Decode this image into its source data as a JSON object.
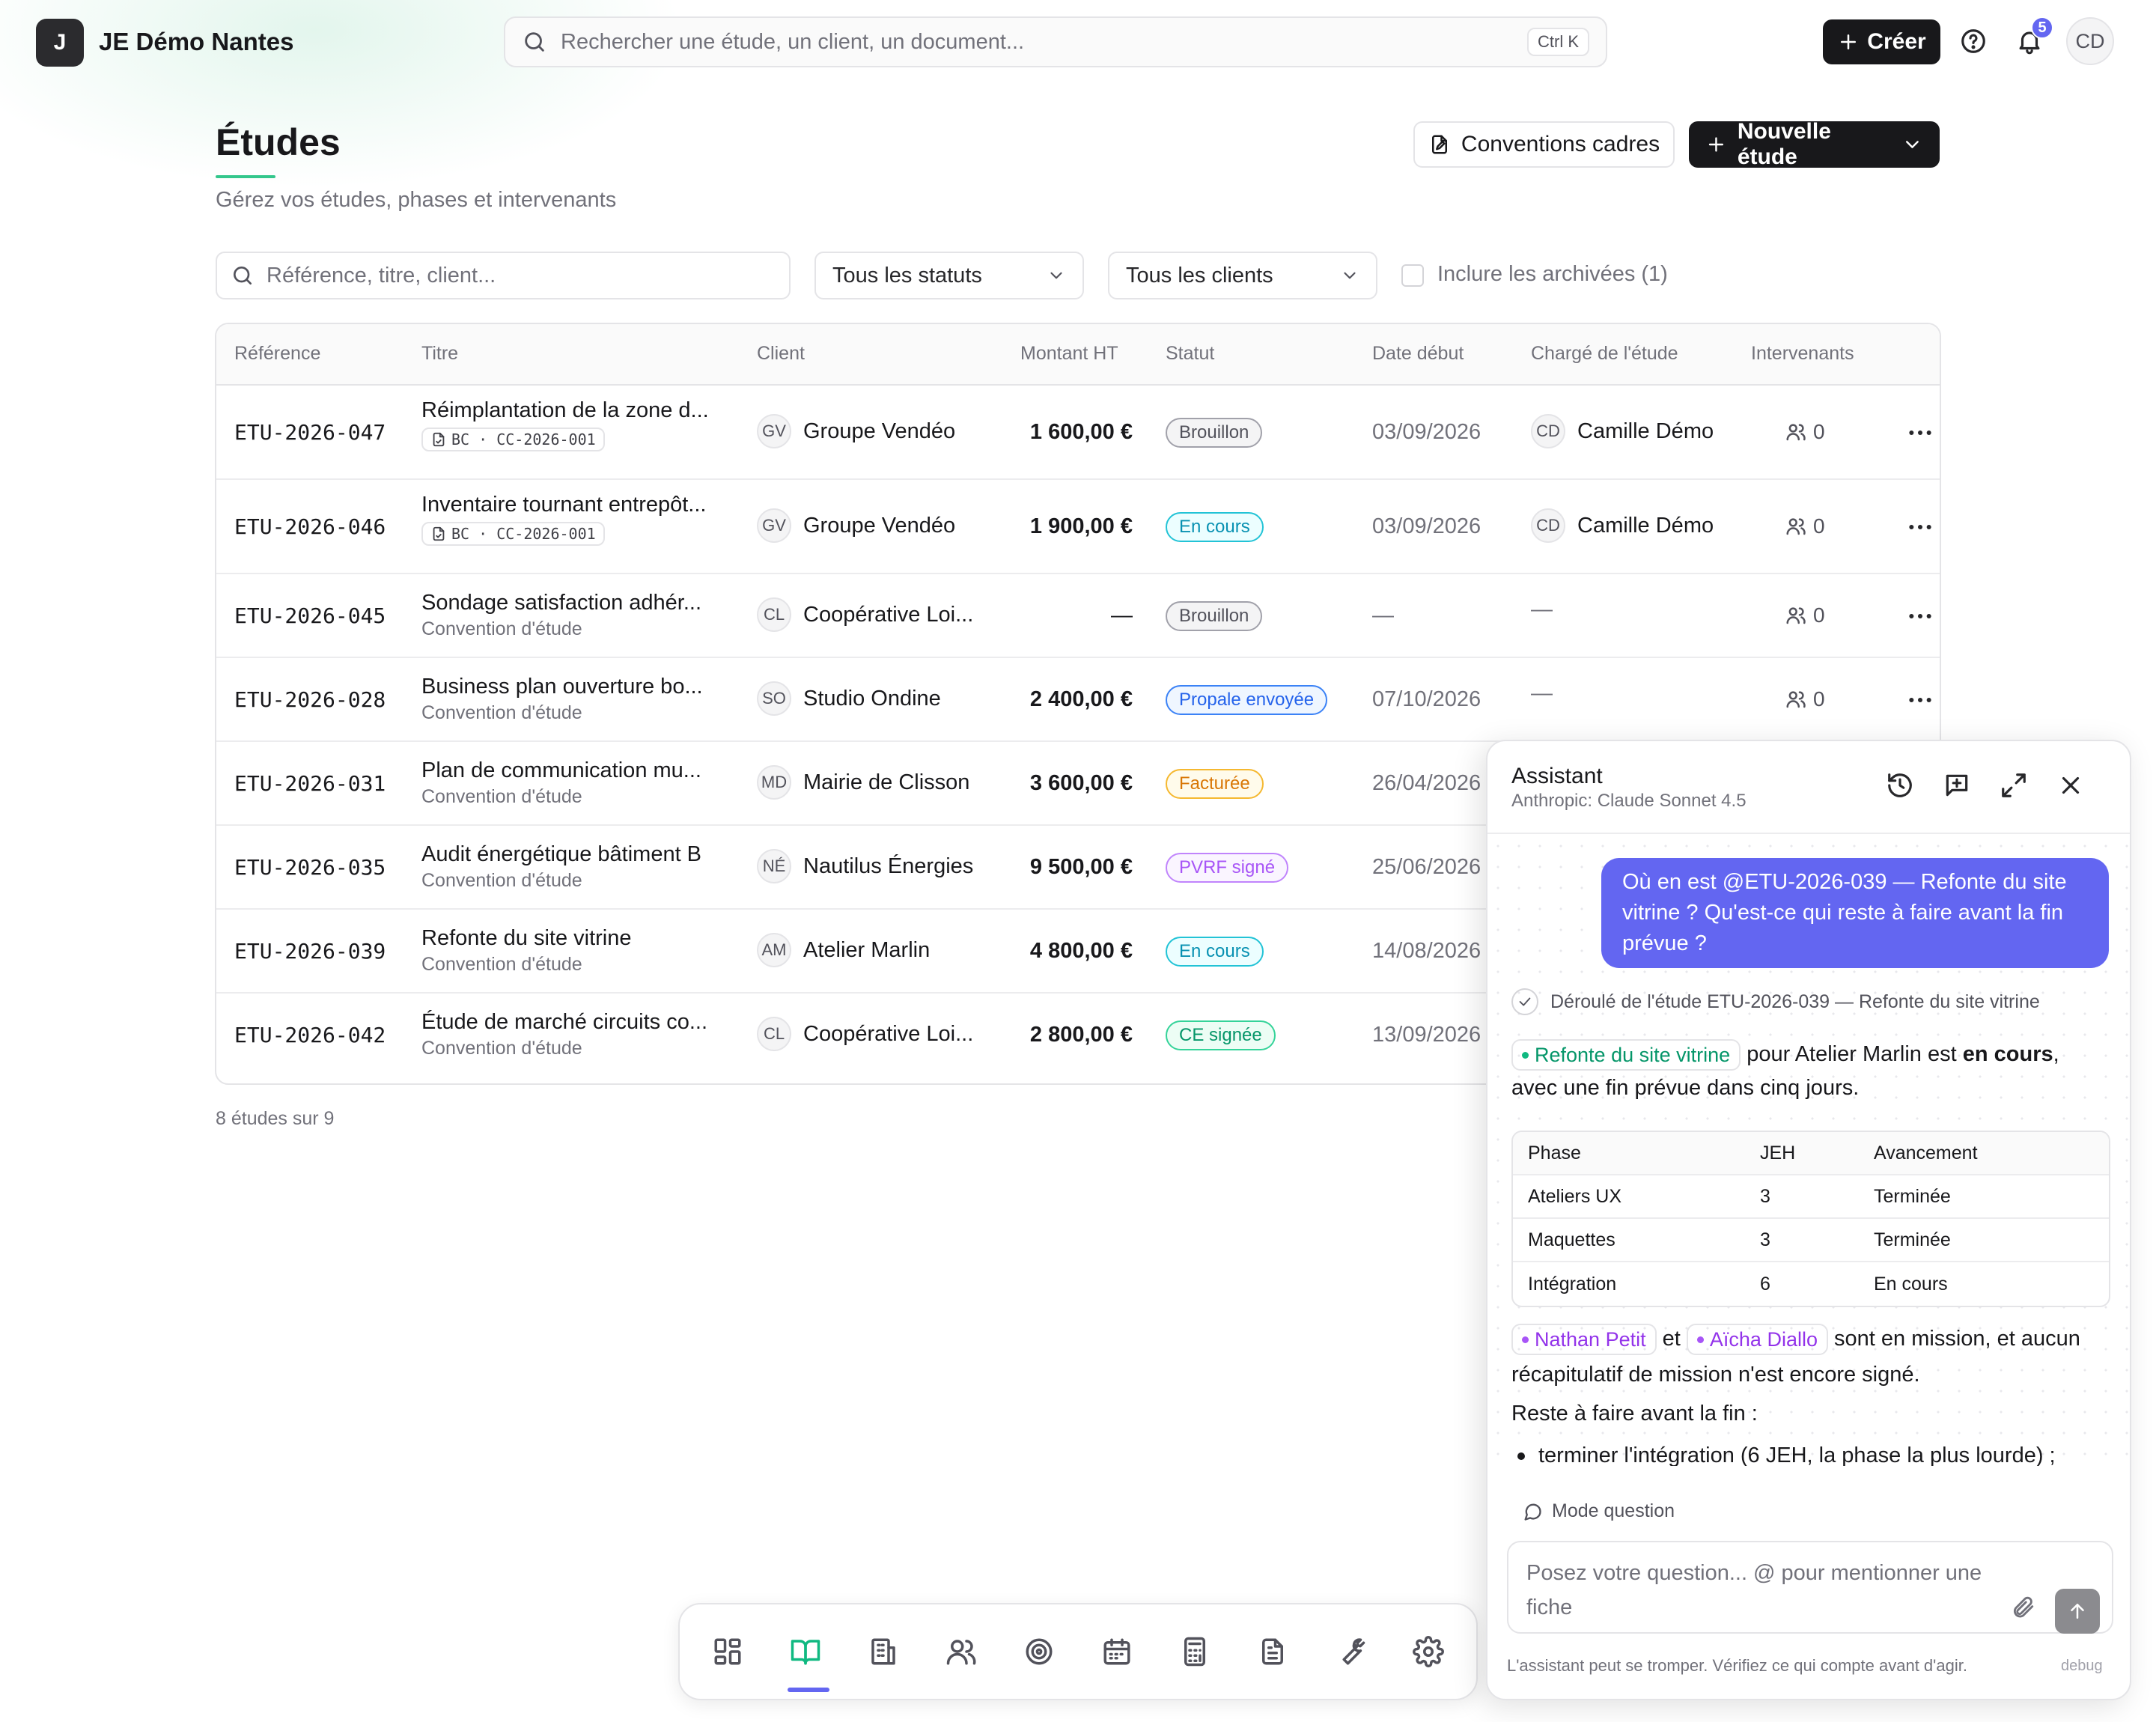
{
  "app": {
    "logo_letter": "J",
    "name": "JE Démo Nantes"
  },
  "global_search": {
    "placeholder": "Rechercher une étude, un client, un document...",
    "shortcut": "Ctrl K"
  },
  "topbar": {
    "create_label": "Créer",
    "notifications_count": "5",
    "user_initials": "CD"
  },
  "page": {
    "title": "Études",
    "subtitle": "Gérez vos études, phases et intervenants",
    "conventions_label": "Conventions cadres",
    "new_study_label": "Nouvelle étude"
  },
  "filters": {
    "search_placeholder": "Référence, titre, client...",
    "status_value": "Tous les statuts",
    "client_value": "Tous les clients",
    "archived_label": "Inclure les archivées (1)"
  },
  "table": {
    "columns": [
      "Référence",
      "Titre",
      "Client",
      "Montant HT",
      "Statut",
      "Date début",
      "Chargé de l'étude",
      "Intervenants"
    ],
    "rows": [
      {
        "ref": "ETU-2026-047",
        "title": "Réimplantation de la zone d...",
        "tag": "BC · CC-2026-001",
        "client_initials": "GV",
        "client": "Groupe Vendéo",
        "amount": "1 600,00 €",
        "status": "Brouillon",
        "date": "03/09/2026",
        "manager_initials": "CD",
        "manager": "Camille Démo",
        "intervenants": "0"
      },
      {
        "ref": "ETU-2026-046",
        "title": "Inventaire tournant entrepôt...",
        "tag": "BC · CC-2026-001",
        "client_initials": "GV",
        "client": "Groupe Vendéo",
        "amount": "1 900,00 €",
        "status": "En cours",
        "date": "03/09/2026",
        "manager_initials": "CD",
        "manager": "Camille Démo",
        "intervenants": "0"
      },
      {
        "ref": "ETU-2026-045",
        "title": "Sondage satisfaction adhér...",
        "subtitle": "Convention d'étude",
        "client_initials": "CL",
        "client": "Coopérative Loi...",
        "amount": "—",
        "status": "Brouillon",
        "date": "—",
        "manager": "—",
        "intervenants": "0"
      },
      {
        "ref": "ETU-2026-028",
        "title": "Business plan ouverture bo...",
        "subtitle": "Convention d'étude",
        "client_initials": "SO",
        "client": "Studio Ondine",
        "amount": "2 400,00 €",
        "status": "Propale envoyée",
        "date": "07/10/2026",
        "manager": "—",
        "intervenants": "0"
      },
      {
        "ref": "ETU-2026-031",
        "title": "Plan de communication mu...",
        "subtitle": "Convention d'étude",
        "client_initials": "MD",
        "client": "Mairie de Clisson",
        "amount": "3 600,00 €",
        "status": "Facturée",
        "date": "26/04/2026"
      },
      {
        "ref": "ETU-2026-035",
        "title": "Audit énergétique bâtiment B",
        "subtitle": "Convention d'étude",
        "client_initials": "NÉ",
        "client": "Nautilus Énergies",
        "amount": "9 500,00 €",
        "status": "PVRF signé",
        "date": "25/06/2026"
      },
      {
        "ref": "ETU-2026-039",
        "title": "Refonte du site vitrine",
        "subtitle": "Convention d'étude",
        "client_initials": "AM",
        "client": "Atelier Marlin",
        "amount": "4 800,00 €",
        "status": "En cours",
        "date": "14/08/2026"
      },
      {
        "ref": "ETU-2026-042",
        "title": "Étude de marché circuits co...",
        "subtitle": "Convention d'étude",
        "client_initials": "CL",
        "client": "Coopérative Loi...",
        "amount": "2 800,00 €",
        "status": "CE signée",
        "date": "13/09/2026"
      }
    ],
    "count_note": "8 études sur 9"
  },
  "status_colors": {
    "Brouillon": {
      "fg": "#52525b",
      "border": "#a1a1aa",
      "bg": "#f4f4f5"
    },
    "En cours": {
      "fg": "#0891b2",
      "border": "#22c3d6",
      "bg": "#ecfeff"
    },
    "Propale envoyée": {
      "fg": "#2563eb",
      "border": "#3b82f6",
      "bg": "#eff6ff"
    },
    "Facturée": {
      "fg": "#d97706",
      "border": "#f5b830",
      "bg": "#fffbeb"
    },
    "PVRF signé": {
      "fg": "#a855f7",
      "border": "#c084fc",
      "bg": "#faf5ff"
    },
    "CE signée": {
      "fg": "#059669",
      "border": "#34d399",
      "bg": "#ecfdf5"
    }
  },
  "dock": {
    "items": [
      "grid-icon",
      "book-open-icon",
      "building-icon",
      "users-icon",
      "target-icon",
      "calendar-icon",
      "calculator-icon",
      "file-text-icon",
      "wrench-icon",
      "settings-icon"
    ],
    "active": "book-open-icon"
  },
  "assistant": {
    "title": "Assistant",
    "model": "Anthropic: Claude Sonnet 4.5",
    "user_message": "Où en est @ETU-2026-039 — Refonte du site vitrine ? Qu'est-ce qui reste à faire avant la fin prévue ?",
    "step_label": "Déroulé de l'étude ETU-2026-039 — Refonte du site vitrine",
    "reply": {
      "chip_study": "Refonte du site vitrine",
      "p1_a": "pour Atelier Marlin est",
      "p1_bold": "en cours",
      "p1_b": ", avec une fin prévue dans cinq jours.",
      "table_headers": [
        "Phase",
        "JEH",
        "Avancement"
      ],
      "table_rows": [
        [
          "Ateliers UX",
          "3",
          "Terminée"
        ],
        [
          "Maquettes",
          "3",
          "Terminée"
        ],
        [
          "Intégration",
          "6",
          "En cours"
        ]
      ],
      "chip_person_1": "Nathan Petit",
      "and": "et",
      "chip_person_2": "Aïcha Diallo",
      "p2": "sont en mission, et aucun récapitulatif de mission n'est encore signé.",
      "p3": "Reste à faire avant la fin :",
      "bullet_1": "terminer l'intégration (6 JEH, la phase la plus lourde) ;"
    },
    "mode_label": "Mode question",
    "input_placeholder": "Posez votre question... @ pour mentionner une fiche",
    "footer": "L'assistant peut se tromper. Vérifiez ce qui compte avant d'agir.",
    "debug": "debug"
  }
}
